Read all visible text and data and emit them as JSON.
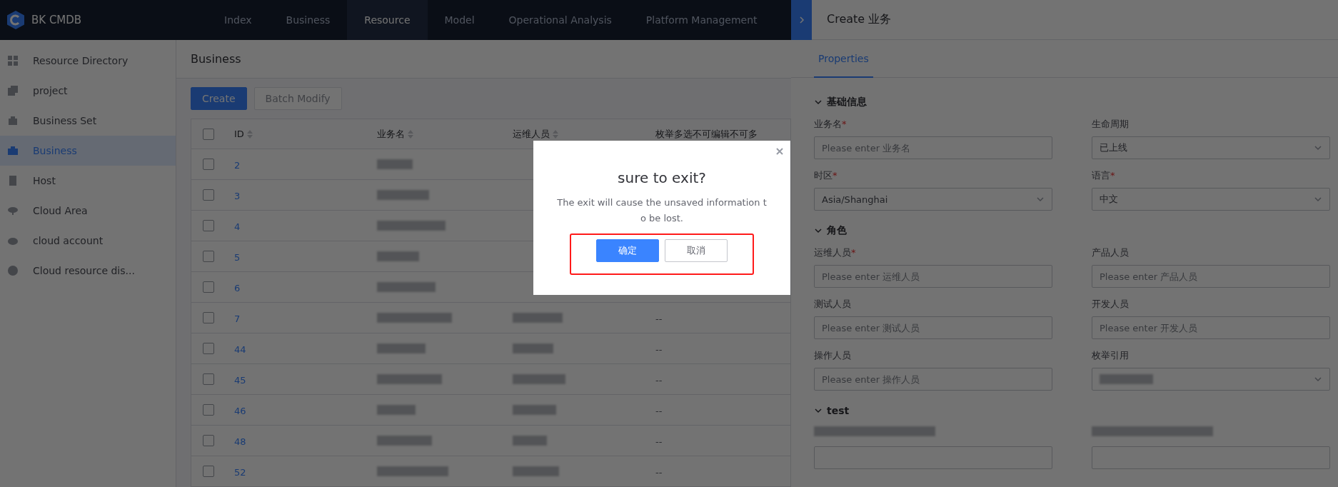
{
  "app": {
    "logo_text": "BK CMDB"
  },
  "nav": [
    {
      "label": "Index",
      "selected": false
    },
    {
      "label": "Business",
      "selected": false
    },
    {
      "label": "Resource",
      "selected": true
    },
    {
      "label": "Model",
      "selected": false
    },
    {
      "label": "Operational Analysis",
      "selected": false
    },
    {
      "label": "Platform Management",
      "selected": false
    }
  ],
  "sidebar": {
    "items": [
      {
        "label": "Resource Directory",
        "selected": false
      },
      {
        "label": "project",
        "selected": false
      },
      {
        "label": "Business Set",
        "selected": false
      },
      {
        "label": "Business",
        "selected": true
      },
      {
        "label": "Host",
        "selected": false
      },
      {
        "label": "Cloud Area",
        "selected": false
      },
      {
        "label": "cloud account",
        "selected": false
      },
      {
        "label": "Cloud resource dis...",
        "selected": false
      }
    ]
  },
  "page": {
    "title": "Business",
    "buttons": [
      {
        "label": "Create",
        "disabled": false
      },
      {
        "label": "Batch Modify",
        "disabled": true
      }
    ]
  },
  "table": {
    "all_checked": false,
    "columns": [
      "ID",
      "业务名",
      "运维人员",
      "枚举多选不可编辑不可多"
    ],
    "rows": [
      {
        "number": "2",
        "checked": false,
        "name_redacted": true,
        "operator_redacted": false
      },
      {
        "number": "3",
        "checked": false,
        "name_redacted": true,
        "operator_redacted": false
      },
      {
        "number": "4",
        "checked": false,
        "name_redacted": true,
        "operator_redacted": false
      },
      {
        "number": "5",
        "checked": false,
        "name_redacted": true,
        "operator_redacted": false
      },
      {
        "number": "6",
        "checked": false,
        "name_redacted": true,
        "operator_redacted": false
      },
      {
        "number": "7",
        "checked": false,
        "name_redacted": true,
        "operator_redacted": true,
        "column_4": "--"
      },
      {
        "number": "44",
        "checked": false,
        "name_redacted": true,
        "operator_redacted": true,
        "column_4": "--"
      },
      {
        "number": "45",
        "checked": false,
        "name_redacted": true,
        "operator_redacted": true,
        "column_4": "--"
      },
      {
        "number": "46",
        "checked": false,
        "name_redacted": true,
        "operator_redacted": true,
        "column_4": "--"
      },
      {
        "number": "48",
        "checked": false,
        "name_redacted": true,
        "operator_redacted": true,
        "column_4": "--"
      },
      {
        "number": "52",
        "checked": false,
        "name_redacted": true,
        "operator_redacted": true,
        "column_4": "--"
      }
    ]
  },
  "panel": {
    "title": "Create 业务",
    "tabs": [
      {
        "label": "Properties",
        "selected": true
      }
    ],
    "sections": [
      {
        "title": "基础信息",
        "expanded": true,
        "fields": [
          {
            "kind": "input",
            "label": "业务名",
            "required_mark": "*",
            "placeholder": "Please enter 业务名"
          },
          {
            "kind": "select",
            "label": "生命周期",
            "value": "已上线"
          },
          {
            "kind": "select",
            "label": "时区",
            "required_mark": "*",
            "value": "Asia/Shanghai"
          },
          {
            "kind": "select",
            "label": "语言",
            "required_mark": "*",
            "value": "中文"
          }
        ]
      },
      {
        "title": "角色",
        "expanded": true,
        "fields": [
          {
            "kind": "input",
            "label": "运维人员",
            "required_mark": "*",
            "placeholder": "Please enter 运维人员"
          },
          {
            "kind": "input",
            "label": "产品人员",
            "placeholder": "Please enter 产品人员"
          },
          {
            "kind": "input",
            "label": "测试人员",
            "placeholder": "Please enter 测试人员"
          },
          {
            "kind": "input",
            "label": "开发人员",
            "placeholder": "Please enter 开发人员"
          },
          {
            "kind": "input",
            "label": "操作人员",
            "placeholder": "Please enter 操作人员"
          },
          {
            "kind": "redacted_select",
            "label": "枚举引用"
          }
        ]
      },
      {
        "title": "test",
        "expanded": true,
        "fields": [
          {
            "kind": "redacted"
          },
          {
            "kind": "redacted"
          }
        ]
      }
    ]
  },
  "modal": {
    "title": "sure to exit?",
    "message": "The exit will cause the unsaved information to be lost.",
    "highlighted": true,
    "buttons": [
      {
        "label": "确定",
        "kind": "primary"
      },
      {
        "label": "取消",
        "kind": "secondary"
      }
    ]
  }
}
